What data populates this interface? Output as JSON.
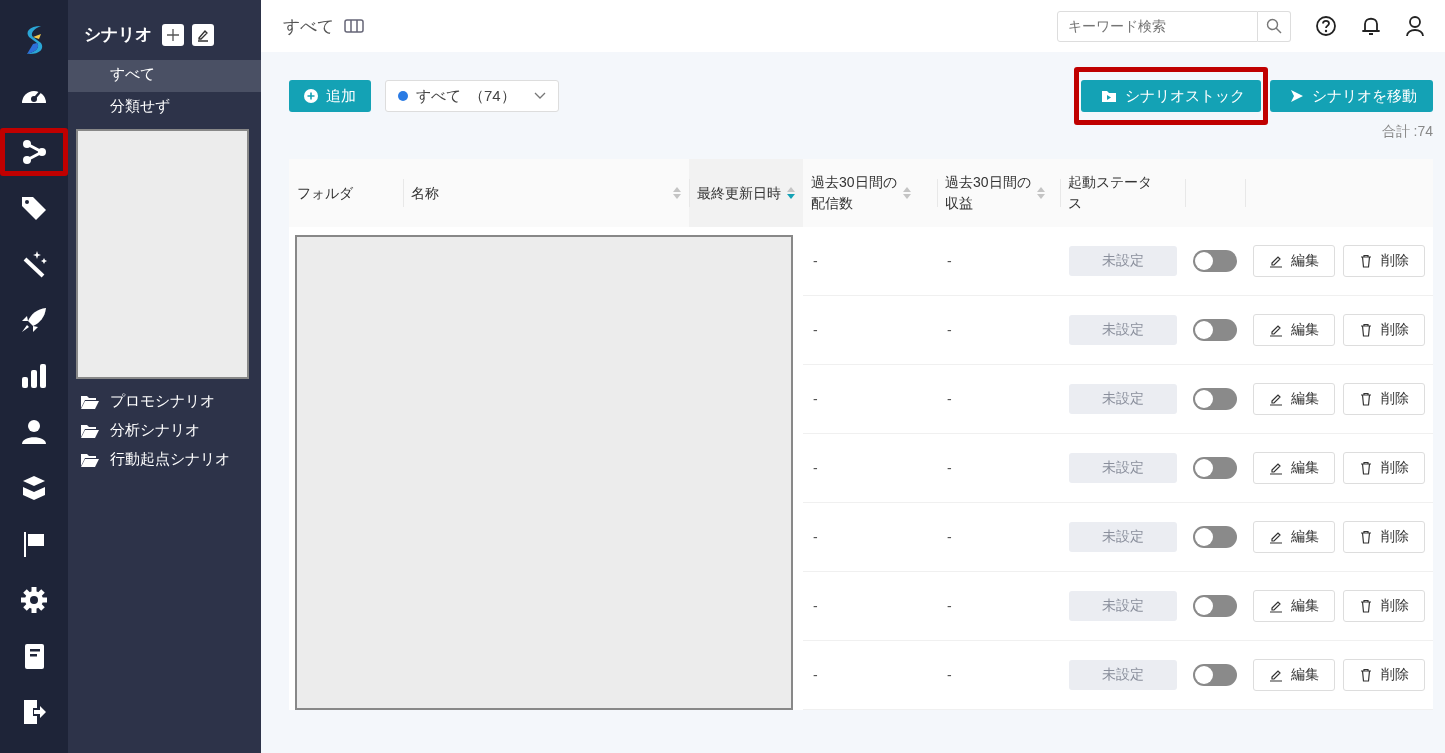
{
  "rail": {
    "items": [
      {
        "kind": "gauge",
        "annotated": false
      },
      {
        "kind": "share",
        "annotated": true
      },
      {
        "kind": "tag",
        "annotated": false
      },
      {
        "kind": "wand",
        "annotated": false
      },
      {
        "kind": "rocket",
        "annotated": false
      },
      {
        "kind": "chart",
        "annotated": false
      },
      {
        "kind": "user",
        "annotated": false
      },
      {
        "kind": "box",
        "annotated": false
      },
      {
        "kind": "flag",
        "annotated": false
      },
      {
        "kind": "gear",
        "annotated": false
      },
      {
        "kind": "book",
        "annotated": false
      },
      {
        "kind": "exit",
        "annotated": false
      }
    ]
  },
  "sidebar": {
    "title": "シナリオ",
    "items": [
      {
        "label": "すべて",
        "selected": true
      },
      {
        "label": "分類せず",
        "selected": false
      }
    ],
    "folders": [
      "プロモシナリオ",
      "分析シナリオ",
      "行動起点シナリオ"
    ]
  },
  "header": {
    "title": "すべて",
    "search": {
      "placeholder": "キーワード検索"
    }
  },
  "toolbar": {
    "add_button": "追加",
    "filter": {
      "label": "すべて",
      "count": "（74）",
      "color": "#2a7be4"
    },
    "stock_button": {
      "label": "シナリオストック",
      "annotated": true
    },
    "move_button": "シナリオを移動",
    "total": "合計 :74"
  },
  "table": {
    "columns": [
      {
        "label": "フォルダ",
        "sortable": false,
        "sorted": false
      },
      {
        "label": "名称",
        "sortable": true,
        "sorted": false
      },
      {
        "label": "最終更新日時",
        "sortable": true,
        "sorted": true
      },
      {
        "label": "過去30日間の配信数",
        "sortable": true,
        "sorted": false
      },
      {
        "label": "過去30日間の収益",
        "sortable": true,
        "sorted": false
      },
      {
        "label": "起動ステータス",
        "sortable": false,
        "sorted": false
      }
    ],
    "rows": [
      {
        "deliveries": "-",
        "revenue": "-",
        "status": "未設定",
        "on": false,
        "edit": "編集",
        "delete": "削除"
      },
      {
        "deliveries": "-",
        "revenue": "-",
        "status": "未設定",
        "on": false,
        "edit": "編集",
        "delete": "削除"
      },
      {
        "deliveries": "-",
        "revenue": "-",
        "status": "未設定",
        "on": false,
        "edit": "編集",
        "delete": "削除"
      },
      {
        "deliveries": "-",
        "revenue": "-",
        "status": "未設定",
        "on": false,
        "edit": "編集",
        "delete": "削除"
      },
      {
        "deliveries": "-",
        "revenue": "-",
        "status": "未設定",
        "on": false,
        "edit": "編集",
        "delete": "削除"
      },
      {
        "deliveries": "-",
        "revenue": "-",
        "status": "未設定",
        "on": false,
        "edit": "編集",
        "delete": "削除"
      },
      {
        "deliveries": "-",
        "revenue": "-",
        "status": "未設定",
        "on": false,
        "edit": "編集",
        "delete": "削除"
      }
    ]
  }
}
